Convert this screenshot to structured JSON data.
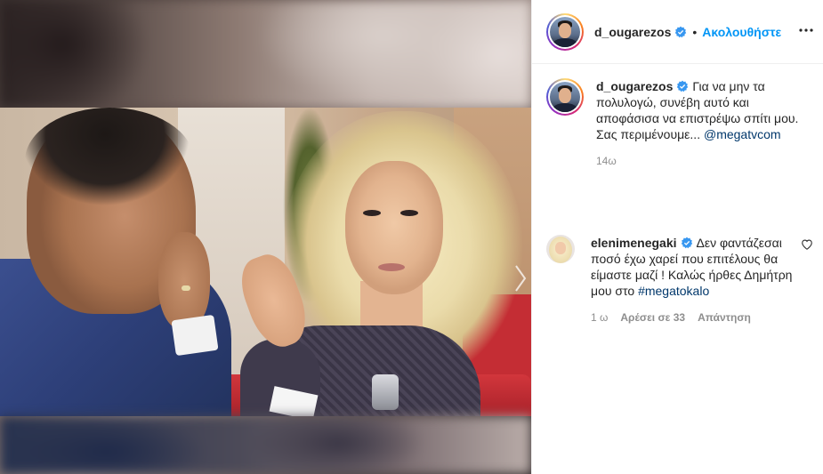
{
  "post": {
    "author": "d_ougarezos",
    "follow_label": "Ακολουθήστε",
    "separator": "•"
  },
  "caption": {
    "username": "d_ougarezos",
    "text": "Για να μην τα πολυλογώ, συνέβη αυτό και αποφάσισα να επιστρέψω σπίτι μου. Σας περιμένουμε...",
    "mention": "@megatvcom",
    "time": "14ω"
  },
  "comment": {
    "username": "elenimenegaki",
    "text": "Δεν φαντάζεσαι ποσό έχω χαρεί που επιτέλους θα είμαστε μαζί ! Καλώς ήρθες Δημήτρη μου στο",
    "hashtag": "#megatokalo",
    "time": "1 ω",
    "likes": "Αρέσει σε 33",
    "reply_label": "Απάντηση"
  },
  "icons": {
    "verified": "verified-badge-icon",
    "more": "more-options-icon",
    "heart": "heart-outline-icon",
    "next": "chevron-right-icon"
  },
  "colors": {
    "link": "#0095f6",
    "verified": "#3897f0",
    "muted": "#8e8e8e",
    "mention": "#00376b"
  }
}
